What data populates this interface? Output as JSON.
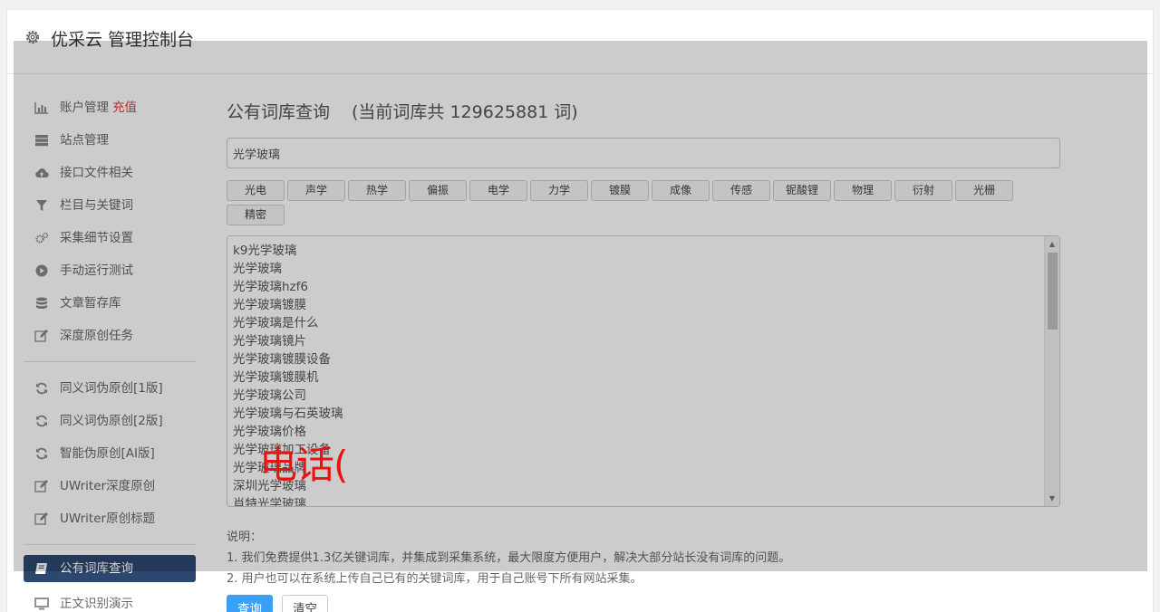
{
  "header": {
    "title": "优采云 管理控制台"
  },
  "sidebar": {
    "group1": [
      {
        "label": "账户管理",
        "extra": "充值",
        "icon": "bar-chart-icon"
      },
      {
        "label": "站点管理",
        "icon": "server-icon"
      },
      {
        "label": "接口文件相关",
        "icon": "cloud-upload-icon"
      },
      {
        "label": "栏目与关键词",
        "icon": "filter-icon"
      },
      {
        "label": "采集细节设置",
        "icon": "gears-icon"
      },
      {
        "label": "手动运行测试",
        "icon": "play-circle-icon"
      },
      {
        "label": "文章暂存库",
        "icon": "database-icon"
      },
      {
        "label": "深度原创任务",
        "icon": "edit-icon"
      }
    ],
    "group2": [
      {
        "label": "同义词伪原创[1版]",
        "icon": "refresh-icon"
      },
      {
        "label": "同义词伪原创[2版]",
        "icon": "refresh-icon"
      },
      {
        "label": "智能伪原创[AI版]",
        "icon": "refresh-icon"
      },
      {
        "label": "UWriter深度原创",
        "icon": "edit-icon"
      },
      {
        "label": "UWriter原创标题",
        "icon": "edit-icon"
      }
    ],
    "group3": [
      {
        "label": "公有词库查询",
        "icon": "book-icon",
        "active": true
      },
      {
        "label": "正文识别演示",
        "icon": "monitor-icon"
      }
    ]
  },
  "main": {
    "title": "公有词库查询",
    "count_text": "(当前词库共 129625881 词)",
    "search_value": "光学玻璃",
    "tags": [
      "光电",
      "声学",
      "热学",
      "偏振",
      "电学",
      "力学",
      "镀膜",
      "成像",
      "传感",
      "铌酸锂",
      "物理",
      "衍射",
      "光栅",
      "精密"
    ],
    "words": [
      "k9光学玻璃",
      "光学玻璃",
      "光学玻璃hzf6",
      "光学玻璃镀膜",
      "光学玻璃是什么",
      "光学玻璃镜片",
      "光学玻璃镀膜设备",
      "光学玻璃镀膜机",
      "光学玻璃公司",
      "光学玻璃与石英玻璃",
      "光学玻璃价格",
      "光学玻璃加工设备",
      "光学玻璃品牌",
      "深圳光学玻璃",
      "肖特光学玻璃"
    ],
    "scroll_up": "▲",
    "scroll_down": "▼",
    "note_title": "说明：",
    "notes": [
      "1. 我们免费提供1.3亿关键词库，并集成到采集系统，最大限度方便用户，解决大部分站长没有词库的问题。",
      "2. 用户也可以在系统上传自己已有的关键词库，用于自己账号下所有网站采集。"
    ],
    "query_button": "查询",
    "clear_button": "清空"
  },
  "watermark": "电话(",
  "colors": {
    "active_nav": "#2d4870",
    "recharge": "#e53935",
    "primary_button": "#3a9ff5",
    "watermark": "#ee1111"
  }
}
